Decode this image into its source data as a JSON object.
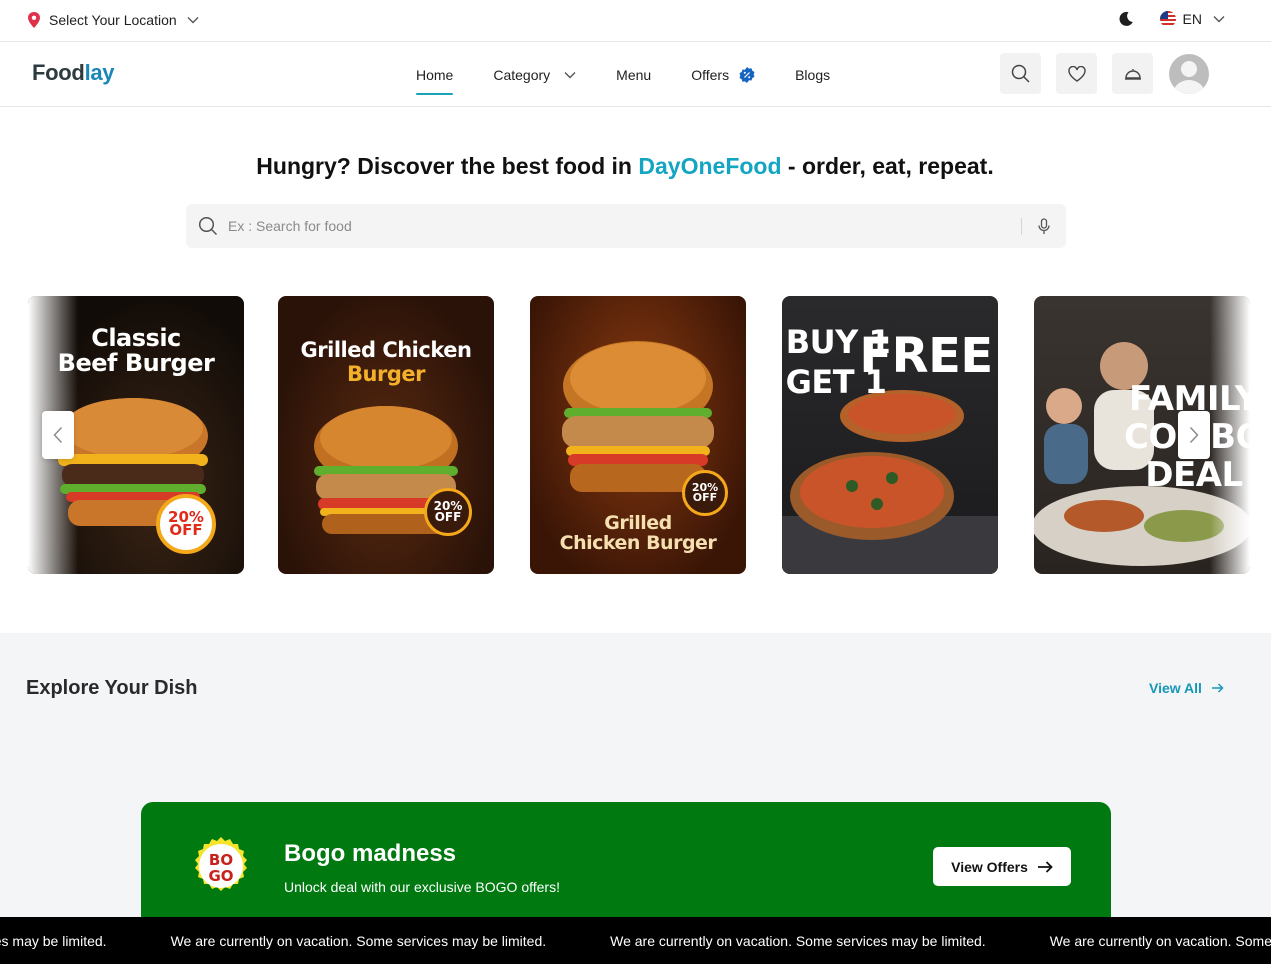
{
  "topbar": {
    "location_label": "Select Your Location",
    "language": "EN"
  },
  "header": {
    "logo_part1": "Food",
    "logo_part2": "lay",
    "nav": [
      {
        "label": "Home",
        "active": true
      },
      {
        "label": "Category"
      },
      {
        "label": "Menu"
      },
      {
        "label": "Offers"
      },
      {
        "label": "Blogs"
      }
    ]
  },
  "hero": {
    "title_before": "Hungry? Discover the best food in ",
    "title_highlight": "DayOneFood",
    "title_after": " - order, eat, repeat.",
    "search_placeholder": "Ex : Search for food"
  },
  "banners": [
    {
      "line1": "Classic",
      "line2": "Beef Burger",
      "badge_top": "20%",
      "badge_bottom": "OFF"
    },
    {
      "line1": "Grilled Chicken",
      "line2": "Burger",
      "badge_top": "20%",
      "badge_bottom": "OFF"
    },
    {
      "line1": "Grilled",
      "line2": "Chicken Burger",
      "badge_top": "20%",
      "badge_bottom": "OFF"
    },
    {
      "line1": "BUY 1",
      "line2": "GET 1",
      "line3": "FREE"
    },
    {
      "line1": "FAMILY",
      "line2": "COMBO",
      "line3": "DEAL"
    }
  ],
  "explore": {
    "title": "Explore Your Dish",
    "view_all": "View All"
  },
  "bogo": {
    "logo_top": "BO",
    "logo_bottom": "GO",
    "title": "Bogo madness",
    "subtitle": "Unlock deal with our exclusive BOGO offers!",
    "button": "View Offers"
  },
  "ticker": {
    "message": "We are currently on vacation. Some services may be limited."
  },
  "colors": {
    "brand_teal": "#14a5c3",
    "logo_blue": "#1987b7",
    "bogo_green": "#007a10",
    "location_pin": "#e0314b"
  },
  "icons": [
    "location-pin-icon",
    "chevron-down-icon",
    "moon-icon",
    "us-flag-icon",
    "search-icon",
    "heart-icon",
    "cloche-icon",
    "avatar",
    "mic-icon",
    "discount-badge-icon",
    "arrow-right-icon",
    "chevron-left-icon",
    "chevron-right-icon"
  ]
}
